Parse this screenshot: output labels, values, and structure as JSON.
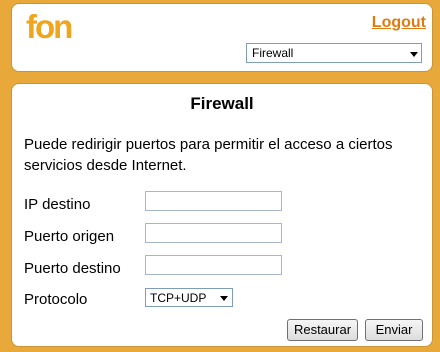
{
  "header": {
    "logo_text": "fon",
    "logout_label": "Logout",
    "nav_select": {
      "selected": "Firewall"
    }
  },
  "main": {
    "title": "Firewall",
    "intro": "Puede redirigir puertos para permitir el acceso a ciertos servicios desde Internet.",
    "fields": {
      "ip_destino": {
        "label": "IP destino",
        "value": ""
      },
      "puerto_origen": {
        "label": "Puerto origen",
        "value": ""
      },
      "puerto_destino": {
        "label": "Puerto destino",
        "value": ""
      },
      "protocolo": {
        "label": "Protocolo",
        "selected": "TCP+UDP"
      }
    },
    "buttons": {
      "restore": "Restaurar",
      "send": "Enviar"
    }
  },
  "colors": {
    "background": "#e8a93a",
    "accent": "#e07a12"
  }
}
